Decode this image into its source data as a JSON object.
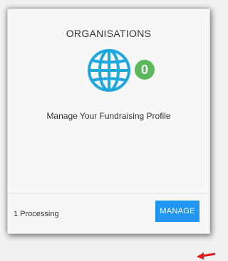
{
  "card": {
    "title": "ORGANISATIONS",
    "count": "0",
    "description": "Manage Your Fundraising Profile",
    "status": "1 Processing",
    "manage_label": "MANAGE"
  },
  "colors": {
    "globe": "#1fa7e0",
    "badge": "#5cb85c",
    "button": "#2196f3",
    "arrow": "#e31b1b"
  },
  "icons": {
    "globe": "globe-icon",
    "arrow": "arrow-pointer-icon"
  }
}
